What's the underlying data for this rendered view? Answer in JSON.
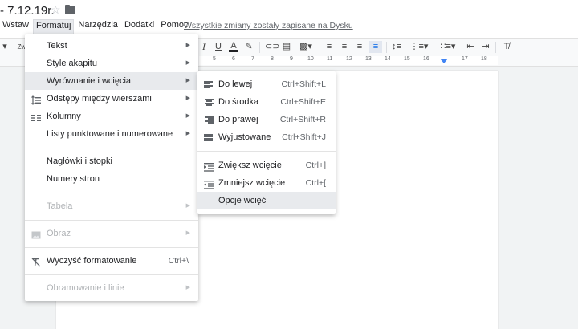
{
  "doc": {
    "title": "- 7.12.19r."
  },
  "menubar": {
    "items": [
      "Wstaw",
      "Formatuj",
      "Narzędzia",
      "Dodatki",
      "Pomoc"
    ],
    "saved_status": "Wszystkie zmiany zostały zapisane na Dysku"
  },
  "toolbar": {
    "zoom_fragment": "Zw",
    "ruler_numbers": [
      "5",
      "6",
      "7",
      "8",
      "9",
      "10",
      "11",
      "12",
      "13",
      "14",
      "15",
      "16",
      "17",
      "18"
    ]
  },
  "format_menu": {
    "items": [
      {
        "label": "Tekst",
        "submenu": true
      },
      {
        "label": "Style akapitu",
        "submenu": true
      },
      {
        "label": "Wyrównanie i wcięcia",
        "submenu": true,
        "highlighted": true
      },
      {
        "label": "Odstępy między wierszami",
        "submenu": true,
        "icon": "line-spacing-icon"
      },
      {
        "label": "Kolumny",
        "submenu": true,
        "icon": "columns-icon"
      },
      {
        "label": "Listy punktowane i numerowane",
        "submenu": true
      },
      {
        "label": "Nagłówki i stopki"
      },
      {
        "label": "Numery stron"
      },
      {
        "label": "Tabela",
        "submenu": true,
        "disabled": true
      },
      {
        "label": "Obraz",
        "submenu": true,
        "disabled": true,
        "icon": "image-icon"
      },
      {
        "label": "Wyczyść formatowanie",
        "shortcut": "Ctrl+\\",
        "icon": "clear-formatting-icon"
      },
      {
        "label": "Obramowanie i linie",
        "submenu": true,
        "disabled": true
      }
    ]
  },
  "align_submenu": {
    "items": [
      {
        "label": "Do lewej",
        "shortcut": "Ctrl+Shift+L",
        "icon": "align-left-icon"
      },
      {
        "label": "Do środka",
        "shortcut": "Ctrl+Shift+E",
        "icon": "align-center-icon"
      },
      {
        "label": "Do prawej",
        "shortcut": "Ctrl+Shift+R",
        "icon": "align-right-icon"
      },
      {
        "label": "Wyjustowane",
        "shortcut": "Ctrl+Shift+J",
        "icon": "align-justify-icon"
      },
      {
        "label": "Zwiększ wcięcie",
        "shortcut": "Ctrl+]",
        "icon": "increase-indent-icon"
      },
      {
        "label": "Zmniejsz wcięcie",
        "shortcut": "Ctrl+[",
        "icon": "decrease-indent-icon"
      },
      {
        "label": "Opcje wcięć",
        "highlighted": true
      }
    ]
  },
  "colors": {
    "accent": "#4285f4",
    "menu_highlight": "#e8eaed",
    "disabled_text": "#b0b3b6"
  }
}
